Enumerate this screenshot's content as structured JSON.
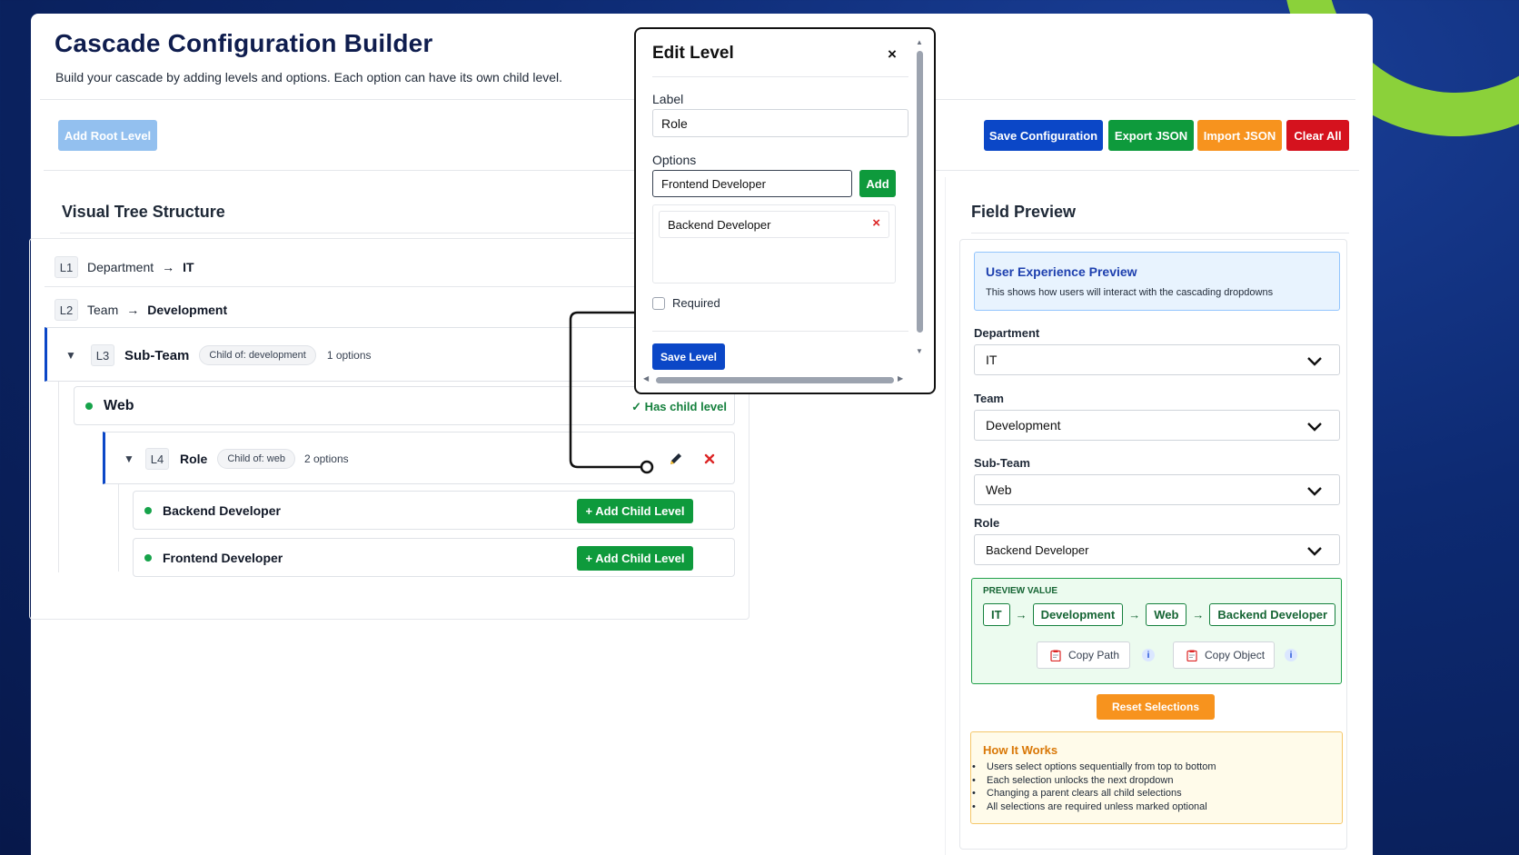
{
  "app": {
    "title": "Cascade Configuration Builder",
    "subtitle": "Build your cascade by adding levels and options. Each option can have its own child level."
  },
  "toolbar": {
    "add_root": "Add Root Level",
    "save": "Save Configuration",
    "export": "Export JSON",
    "import": "Import JSON",
    "clear": "Clear All"
  },
  "tree": {
    "title": "Visual Tree Structure",
    "l1": {
      "level": "L1",
      "name": "Department",
      "arrow": "→",
      "value": "IT"
    },
    "l2": {
      "level": "L2",
      "name": "Team",
      "arrow": "→",
      "value": "Development"
    },
    "l3": {
      "toggle": "▼",
      "level": "L3",
      "name": "Sub-Team",
      "child_of": "Child of: development",
      "options": "1 options"
    },
    "web": {
      "name": "Web",
      "status": "✓ Has child level"
    },
    "l4": {
      "toggle": "▼",
      "level": "L4",
      "name": "Role",
      "child_of": "Child of: web",
      "options": "2 options"
    },
    "options": [
      {
        "name": "Backend Developer",
        "action": "+ Add Child Level"
      },
      {
        "name": "Frontend Developer",
        "action": "+ Add Child Level"
      }
    ]
  },
  "modal": {
    "title": "Edit Level",
    "close": "×",
    "label_caption": "Label",
    "label_value": "Role",
    "options_caption": "Options",
    "option_input": "Frontend Developer",
    "add": "Add",
    "existing_option": "Backend Developer",
    "remove": "×",
    "required": "Required",
    "save": "Save Level"
  },
  "preview": {
    "title": "Field Preview",
    "ux_title": "User Experience Preview",
    "ux_desc": "This shows how users will interact with the cascading dropdowns",
    "fields": [
      {
        "label": "Department",
        "value": "IT"
      },
      {
        "label": "Team",
        "value": "Development"
      },
      {
        "label": "Sub-Team",
        "value": "Web"
      },
      {
        "label": "Role",
        "value": "Backend Developer"
      }
    ],
    "value_title": "PREVIEW VALUE",
    "path": [
      "IT",
      "Development",
      "Web",
      "Backend Developer"
    ],
    "arrow": "→",
    "copy_path": "Copy Path",
    "copy_object": "Copy Object",
    "info": "i",
    "reset": "Reset Selections",
    "how_title": "How It Works",
    "how_items": [
      "Users select options sequentially from top to bottom",
      "Each selection unlocks the next dropdown",
      "Changing a parent clears all child selections",
      "All selections are required unless marked optional"
    ]
  },
  "colors": {
    "primary": "#0b47c7",
    "success": "#0e9a3c",
    "warning": "#f7931e",
    "danger": "#d5121e",
    "disabled": "#93c0ef"
  }
}
